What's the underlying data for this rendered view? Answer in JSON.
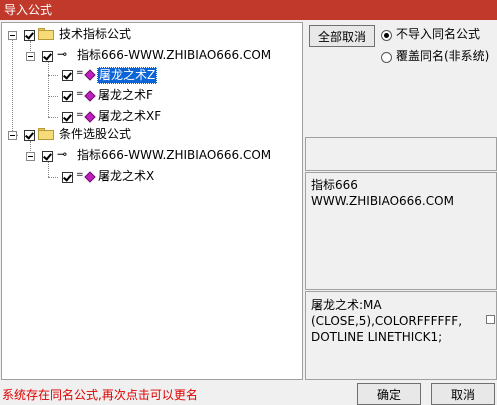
{
  "window": {
    "title": "导入公式"
  },
  "tree": {
    "groups": [
      {
        "label": "技术指标公式",
        "child": {
          "label": "指标666-WWW.ZHIBIAO666.COM",
          "items": [
            "屠龙之术Z",
            "屠龙之术F",
            "屠龙之术XF"
          ]
        }
      },
      {
        "label": "条件选股公式",
        "child": {
          "label": "指标666-WWW.ZHIBIAO666.COM",
          "items": [
            "屠龙之术X"
          ]
        }
      }
    ],
    "selected_item": "屠龙之术Z"
  },
  "options": {
    "cancel_all_label": "全部取消",
    "radio_no_import": "不导入同名公式",
    "radio_overwrite": "覆盖同名(非系统)"
  },
  "info": {
    "description": "指标666\nWWW.ZHIBIAO666.COM",
    "formula": "屠龙之术:MA\n(CLOSE,5),COLORFFFFFF,\nDOTLINE LINETHICK1;"
  },
  "footer": {
    "status": "系统存在同名公式,再次点击可以更名",
    "ok_label": "确定",
    "cancel_label": "取消"
  },
  "colors": {
    "titlebar": "#c0392b",
    "selection": "#0a64d6",
    "status_text": "#e00000"
  }
}
